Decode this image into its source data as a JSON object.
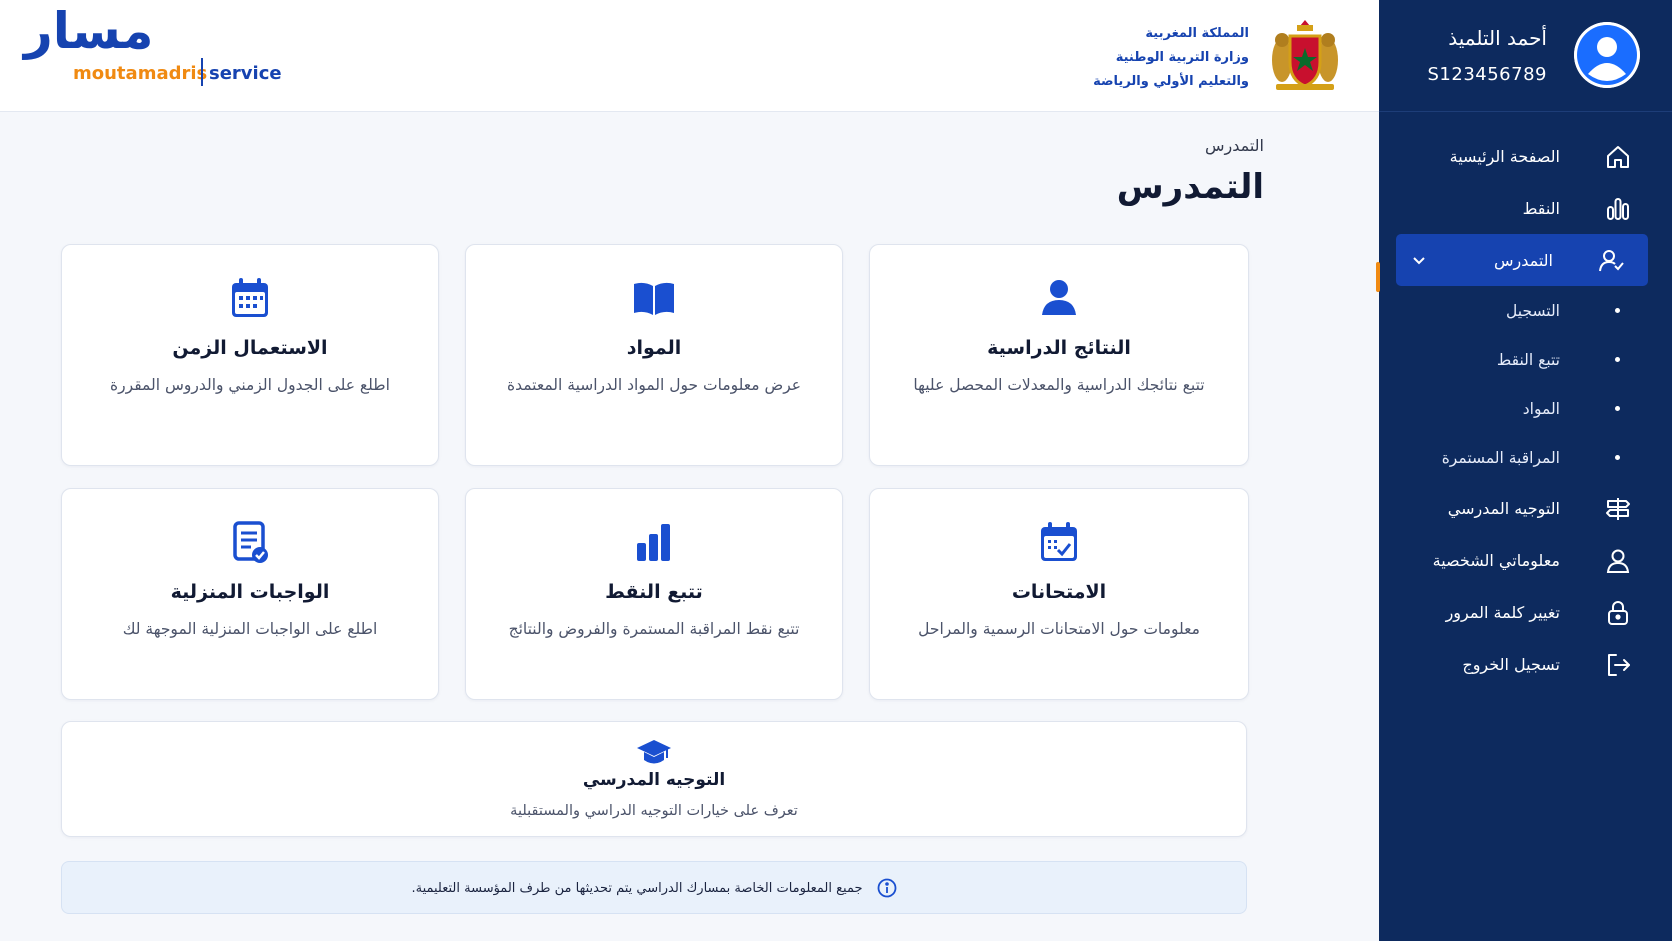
{
  "header": {
    "logo": {
      "arabic": "مسار",
      "brand": "moutamadris",
      "service": "service"
    },
    "ministry": {
      "line1": "المملكة المغربية",
      "line2": "وزارة التربية الوطنية",
      "line3": "والتعليم الأولي والرياضة"
    }
  },
  "profile": {
    "name": "أحمد التلميذ",
    "id": "S123456789"
  },
  "sidebar": {
    "items": [
      {
        "label": "الصفحة الرئيسية",
        "icon": "home-icon"
      },
      {
        "label": "النقط",
        "icon": "bar-chart-icon"
      },
      {
        "label": "التمدرس",
        "icon": "user-school-icon",
        "active": true
      },
      {
        "label": "التوجيه المدرسي",
        "icon": "signpost-icon"
      },
      {
        "label": "معلوماتي الشخصية",
        "icon": "user-icon"
      },
      {
        "label": "تغيير كلمة المرور",
        "icon": "lock-icon"
      },
      {
        "label": "تسجيل الخروج",
        "icon": "logout-icon"
      }
    ],
    "subitems": [
      {
        "label": "التسجيل"
      },
      {
        "label": "تتبع النقط"
      },
      {
        "label": "المواد"
      },
      {
        "label": "المراقبة المستمرة"
      }
    ]
  },
  "main": {
    "breadcrumb": "التمدرس",
    "title": "التمدرس",
    "cards": [
      {
        "title": "النتائج الدراسية",
        "desc": "تتبع نتائجك الدراسية والمعدلات المحصل عليها",
        "icon": "user-icon"
      },
      {
        "title": "المواد",
        "desc": "عرض معلومات حول المواد الدراسية المعتمدة",
        "icon": "book-icon"
      },
      {
        "title": "الاستعمال الزمن",
        "desc": "اطلع على الجدول الزمني والدروس المقررة",
        "icon": "calendar-icon"
      },
      {
        "title": "الامتحانات",
        "desc": "معلومات حول الامتحانات الرسمية والمراحل",
        "icon": "calendar-check-icon"
      },
      {
        "title": "تتبع النقط",
        "desc": "تتبع نقط المراقبة المستمرة والفروض والنتائج",
        "icon": "bar-chart-icon"
      },
      {
        "title": "الواجبات المنزلية",
        "desc": "اطلع على الواجبات المنزلية الموجهة لك",
        "icon": "document-check-icon"
      },
      {
        "title": "التوجيه المدرسي",
        "desc": "تعرف على خيارات التوجيه الدراسي والمستقبلية",
        "icon": "graduation-cap-icon"
      }
    ],
    "info": "جميع المعلومات الخاصة بمسارك الدراسي يتم تحديثها من طرف المؤسسة التعليمية."
  },
  "colors": {
    "sidebar_bg": "#0d2a5e",
    "active_bg": "#1643b0",
    "accent_orange": "#f08a12",
    "icon_blue": "#1a4fd0",
    "page_bg": "#f5f7fb"
  }
}
